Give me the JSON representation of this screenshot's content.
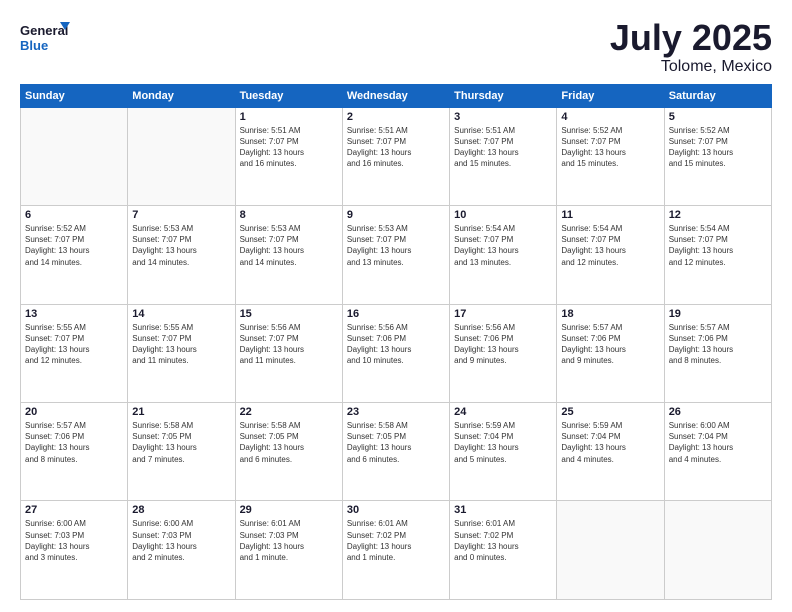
{
  "logo": {
    "line1": "General",
    "line2": "Blue"
  },
  "title": "July 2025",
  "location": "Tolome, Mexico",
  "days_header": [
    "Sunday",
    "Monday",
    "Tuesday",
    "Wednesday",
    "Thursday",
    "Friday",
    "Saturday"
  ],
  "weeks": [
    [
      {
        "day": "",
        "info": ""
      },
      {
        "day": "",
        "info": ""
      },
      {
        "day": "1",
        "info": "Sunrise: 5:51 AM\nSunset: 7:07 PM\nDaylight: 13 hours\nand 16 minutes."
      },
      {
        "day": "2",
        "info": "Sunrise: 5:51 AM\nSunset: 7:07 PM\nDaylight: 13 hours\nand 16 minutes."
      },
      {
        "day": "3",
        "info": "Sunrise: 5:51 AM\nSunset: 7:07 PM\nDaylight: 13 hours\nand 15 minutes."
      },
      {
        "day": "4",
        "info": "Sunrise: 5:52 AM\nSunset: 7:07 PM\nDaylight: 13 hours\nand 15 minutes."
      },
      {
        "day": "5",
        "info": "Sunrise: 5:52 AM\nSunset: 7:07 PM\nDaylight: 13 hours\nand 15 minutes."
      }
    ],
    [
      {
        "day": "6",
        "info": "Sunrise: 5:52 AM\nSunset: 7:07 PM\nDaylight: 13 hours\nand 14 minutes."
      },
      {
        "day": "7",
        "info": "Sunrise: 5:53 AM\nSunset: 7:07 PM\nDaylight: 13 hours\nand 14 minutes."
      },
      {
        "day": "8",
        "info": "Sunrise: 5:53 AM\nSunset: 7:07 PM\nDaylight: 13 hours\nand 14 minutes."
      },
      {
        "day": "9",
        "info": "Sunrise: 5:53 AM\nSunset: 7:07 PM\nDaylight: 13 hours\nand 13 minutes."
      },
      {
        "day": "10",
        "info": "Sunrise: 5:54 AM\nSunset: 7:07 PM\nDaylight: 13 hours\nand 13 minutes."
      },
      {
        "day": "11",
        "info": "Sunrise: 5:54 AM\nSunset: 7:07 PM\nDaylight: 13 hours\nand 12 minutes."
      },
      {
        "day": "12",
        "info": "Sunrise: 5:54 AM\nSunset: 7:07 PM\nDaylight: 13 hours\nand 12 minutes."
      }
    ],
    [
      {
        "day": "13",
        "info": "Sunrise: 5:55 AM\nSunset: 7:07 PM\nDaylight: 13 hours\nand 12 minutes."
      },
      {
        "day": "14",
        "info": "Sunrise: 5:55 AM\nSunset: 7:07 PM\nDaylight: 13 hours\nand 11 minutes."
      },
      {
        "day": "15",
        "info": "Sunrise: 5:56 AM\nSunset: 7:07 PM\nDaylight: 13 hours\nand 11 minutes."
      },
      {
        "day": "16",
        "info": "Sunrise: 5:56 AM\nSunset: 7:06 PM\nDaylight: 13 hours\nand 10 minutes."
      },
      {
        "day": "17",
        "info": "Sunrise: 5:56 AM\nSunset: 7:06 PM\nDaylight: 13 hours\nand 9 minutes."
      },
      {
        "day": "18",
        "info": "Sunrise: 5:57 AM\nSunset: 7:06 PM\nDaylight: 13 hours\nand 9 minutes."
      },
      {
        "day": "19",
        "info": "Sunrise: 5:57 AM\nSunset: 7:06 PM\nDaylight: 13 hours\nand 8 minutes."
      }
    ],
    [
      {
        "day": "20",
        "info": "Sunrise: 5:57 AM\nSunset: 7:06 PM\nDaylight: 13 hours\nand 8 minutes."
      },
      {
        "day": "21",
        "info": "Sunrise: 5:58 AM\nSunset: 7:05 PM\nDaylight: 13 hours\nand 7 minutes."
      },
      {
        "day": "22",
        "info": "Sunrise: 5:58 AM\nSunset: 7:05 PM\nDaylight: 13 hours\nand 6 minutes."
      },
      {
        "day": "23",
        "info": "Sunrise: 5:58 AM\nSunset: 7:05 PM\nDaylight: 13 hours\nand 6 minutes."
      },
      {
        "day": "24",
        "info": "Sunrise: 5:59 AM\nSunset: 7:04 PM\nDaylight: 13 hours\nand 5 minutes."
      },
      {
        "day": "25",
        "info": "Sunrise: 5:59 AM\nSunset: 7:04 PM\nDaylight: 13 hours\nand 4 minutes."
      },
      {
        "day": "26",
        "info": "Sunrise: 6:00 AM\nSunset: 7:04 PM\nDaylight: 13 hours\nand 4 minutes."
      }
    ],
    [
      {
        "day": "27",
        "info": "Sunrise: 6:00 AM\nSunset: 7:03 PM\nDaylight: 13 hours\nand 3 minutes."
      },
      {
        "day": "28",
        "info": "Sunrise: 6:00 AM\nSunset: 7:03 PM\nDaylight: 13 hours\nand 2 minutes."
      },
      {
        "day": "29",
        "info": "Sunrise: 6:01 AM\nSunset: 7:03 PM\nDaylight: 13 hours\nand 1 minute."
      },
      {
        "day": "30",
        "info": "Sunrise: 6:01 AM\nSunset: 7:02 PM\nDaylight: 13 hours\nand 1 minute."
      },
      {
        "day": "31",
        "info": "Sunrise: 6:01 AM\nSunset: 7:02 PM\nDaylight: 13 hours\nand 0 minutes."
      },
      {
        "day": "",
        "info": ""
      },
      {
        "day": "",
        "info": ""
      }
    ]
  ]
}
